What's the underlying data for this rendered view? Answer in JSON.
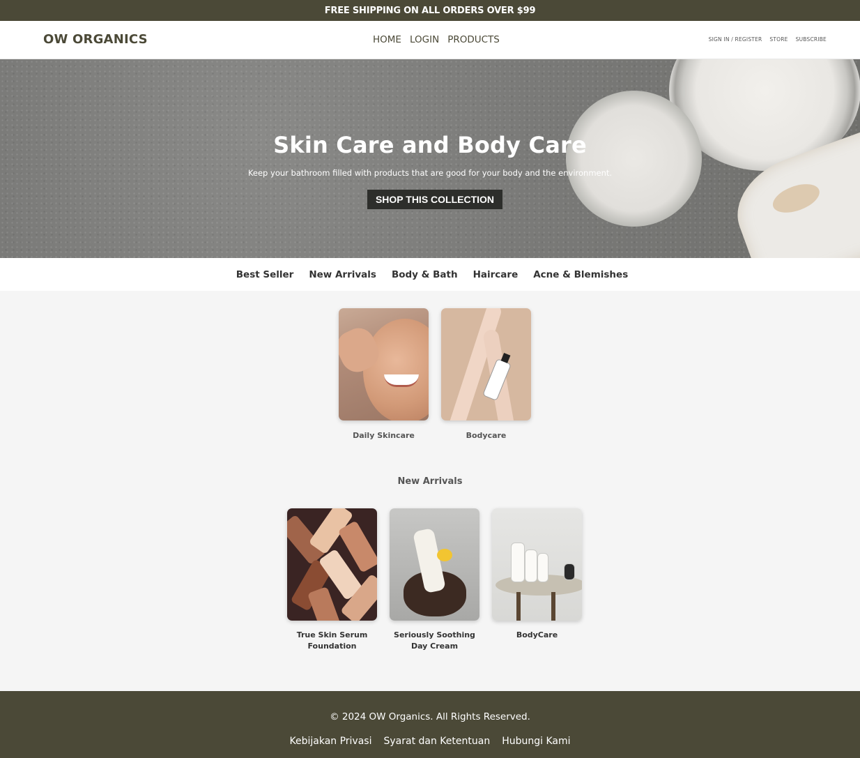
{
  "promo": {
    "text": "FREE SHIPPING ON ALL ORDERS OVER $99"
  },
  "header": {
    "logo": "OW ORGANICS",
    "nav": [
      "HOME",
      "LOGIN",
      "PRODUCTS"
    ],
    "utility": [
      "SIGN IN / REGISTER",
      "STORE",
      "SUBSCRIBE"
    ]
  },
  "hero": {
    "title": "Skin Care and Body Care",
    "subtitle": "Keep your bathroom filled with products that are good for your body and the environment.",
    "cta": "SHOP THIS COLLECTION"
  },
  "categories": [
    "Best Seller",
    "New Arrivals",
    "Body & Bath",
    "Haircare",
    "Acne & Blemishes"
  ],
  "featured": [
    {
      "label": "Daily Skincare",
      "image": "face-photo"
    },
    {
      "label": "Bodycare",
      "image": "hands-bottle-photo"
    }
  ],
  "new_arrivals": {
    "title": "New Arrivals",
    "items": [
      {
        "name": "True Skin Serum Foundation",
        "image": "serum-bottles-photo"
      },
      {
        "name": "Seriously Soothing Day Cream",
        "image": "hands-cream-photo"
      },
      {
        "name": "BodyCare",
        "image": "bottles-tray-photo"
      }
    ]
  },
  "footer": {
    "copyright": "© 2024 OW Organics. All Rights Reserved.",
    "links": [
      "Kebijakan Privasi",
      "Syarat dan Ketentuan",
      "Hubungi Kami"
    ]
  },
  "colors": {
    "brand": "#4b4937",
    "cta": "#2d2e2b",
    "background": "#f5f5f5"
  }
}
